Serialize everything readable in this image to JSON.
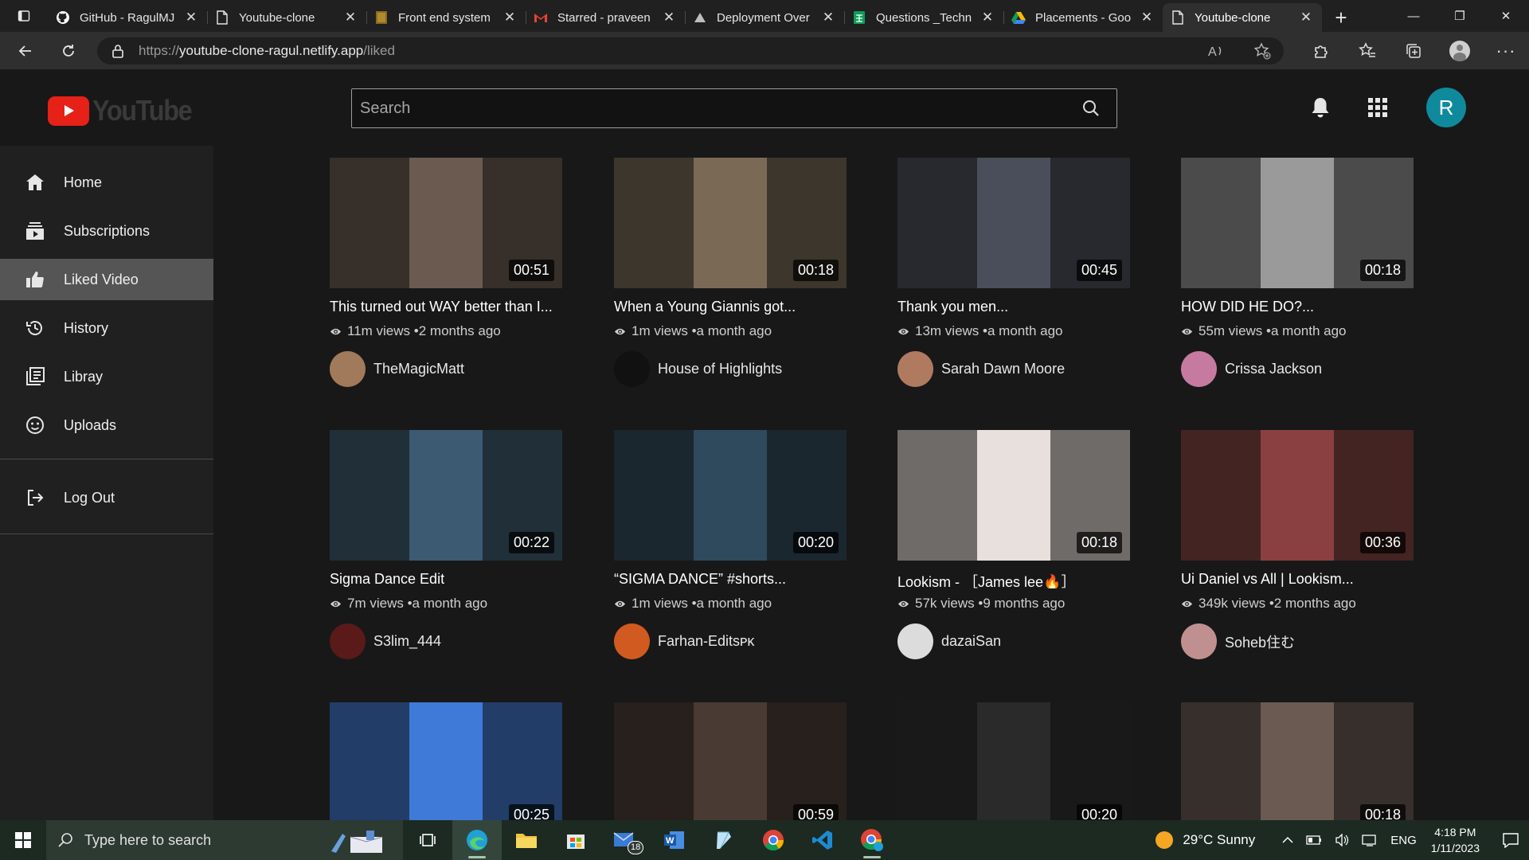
{
  "browser": {
    "tabs": [
      {
        "title": "GitHub - RagulMJ",
        "favicon": "github-icon"
      },
      {
        "title": "Youtube-clone",
        "favicon": "page-icon"
      },
      {
        "title": "Front end system",
        "favicon": "bookmark-icon"
      },
      {
        "title": "Starred - praveen",
        "favicon": "gmail-icon"
      },
      {
        "title": "Deployment Over",
        "favicon": "vercel-icon"
      },
      {
        "title": "Questions _Techn",
        "favicon": "sheets-icon"
      },
      {
        "title": "Placements - Goo",
        "favicon": "drive-icon"
      },
      {
        "title": "Youtube-clone",
        "favicon": "page-icon",
        "active": true
      }
    ],
    "url_scheme": "https://",
    "url_host": "youtube-clone-ragul.netlify.app",
    "url_path": "/liked"
  },
  "header": {
    "logo_text": "YouTube",
    "search_placeholder": "Search",
    "avatar_letter": "R",
    "avatar_color": "#0f8a9c"
  },
  "sidebar": {
    "items": [
      {
        "label": "Home",
        "icon": "home-icon"
      },
      {
        "label": "Subscriptions",
        "icon": "subscriptions-icon"
      },
      {
        "label": "Liked Video",
        "icon": "thumbs-up-icon",
        "active": true
      },
      {
        "label": "History",
        "icon": "history-icon"
      },
      {
        "label": "Libray",
        "icon": "library-icon"
      },
      {
        "label": "Uploads",
        "icon": "smiley-icon"
      }
    ],
    "logout_label": "Log Out"
  },
  "videos": [
    {
      "title": "This turned out WAY better than I...",
      "duration": "00:51",
      "views": "11m views",
      "age": "•2 months ago",
      "channel": "TheMagicMatt",
      "thumb_color": "#6b5a50",
      "avatar_color": "#a07a5a"
    },
    {
      "title": "When a Young Giannis got...",
      "duration": "00:18",
      "views": "1m views",
      "age": "•a month ago",
      "channel": "House of Highlights",
      "thumb_color": "#7a6a55",
      "avatar_color": "#111111"
    },
    {
      "title": "Thank you men...",
      "duration": "00:45",
      "views": "13m views",
      "age": "•a month ago",
      "channel": "Sarah Dawn Moore",
      "thumb_color": "#4a4e5a",
      "avatar_color": "#b07a60"
    },
    {
      "title": "HOW DID HE DO?...",
      "duration": "00:18",
      "views": "55m views",
      "age": "•a month ago",
      "channel": "Crissa Jackson",
      "thumb_color": "#9a9a9a",
      "avatar_color": "#c77aa0"
    },
    {
      "title": "Sigma Dance Edit",
      "duration": "00:22",
      "views": "7m views",
      "age": "•a month ago",
      "channel": "S3lim_444",
      "thumb_color": "#3c5a72",
      "avatar_color": "#5a1a1a"
    },
    {
      "title": "“SIGMA DANCE” #shorts...",
      "duration": "00:20",
      "views": "1m views",
      "age": "•a month ago",
      "channel": "Farhan-Editsᴘᴋ",
      "thumb_color": "#2f4a5c",
      "avatar_color": "#d05a20"
    },
    {
      "title": "Lookism - ［James lee🔥］",
      "duration": "00:18",
      "views": "57k views",
      "age": "•9 months ago",
      "channel": "dazaiSan",
      "thumb_color": "#e8e0dc",
      "avatar_color": "#dcdcdc"
    },
    {
      "title": "Ui Daniel vs All | Lookism...",
      "duration": "00:36",
      "views": "349k views",
      "age": "•2 months ago",
      "channel": "Soheb住む",
      "thumb_color": "#8a4040",
      "avatar_color": "#c09090"
    },
    {
      "title": "",
      "duration": "00:25",
      "views": "",
      "age": "",
      "channel": "",
      "thumb_color": "#3f7ad8",
      "avatar_color": "#333333"
    },
    {
      "title": "",
      "duration": "00:59",
      "views": "",
      "age": "",
      "channel": "",
      "thumb_color": "#4a3a34",
      "avatar_color": "#333333"
    },
    {
      "title": "",
      "duration": "00:20",
      "views": "",
      "age": "",
      "channel": "",
      "thumb_color": "#2a2a2a",
      "avatar_color": "#333333"
    },
    {
      "title": "",
      "duration": "00:18",
      "views": "",
      "age": "",
      "channel": "",
      "thumb_color": "#6a5a52",
      "avatar_color": "#333333"
    }
  ],
  "taskbar": {
    "search_placeholder": "Type here to search",
    "mail_badge": "18",
    "weather": "29°C  Sunny",
    "language": "ENG",
    "time": "4:18 PM",
    "date": "1/11/2023"
  }
}
